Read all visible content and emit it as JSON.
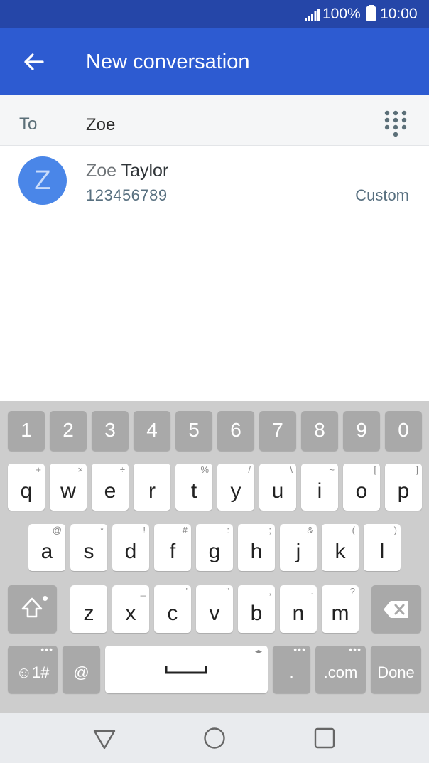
{
  "status_bar": {
    "battery": "100%",
    "time": "10:00"
  },
  "app_bar": {
    "title": "New conversation"
  },
  "recipient": {
    "label": "To",
    "value": "Zoe"
  },
  "contact": {
    "initial": "Z",
    "name_match": "Zoe",
    "name_rest": " Taylor",
    "phone": "123456789",
    "phone_type": "Custom",
    "avatar_color": "#4a86e8"
  },
  "keyboard": {
    "number_row": [
      "1",
      "2",
      "3",
      "4",
      "5",
      "6",
      "7",
      "8",
      "9",
      "0"
    ],
    "row1": [
      {
        "key": "q",
        "alt": "+"
      },
      {
        "key": "w",
        "alt": "×"
      },
      {
        "key": "e",
        "alt": "÷"
      },
      {
        "key": "r",
        "alt": "="
      },
      {
        "key": "t",
        "alt": "%"
      },
      {
        "key": "y",
        "alt": "/"
      },
      {
        "key": "u",
        "alt": "\\"
      },
      {
        "key": "i",
        "alt": "~"
      },
      {
        "key": "o",
        "alt": "["
      },
      {
        "key": "p",
        "alt": "]"
      }
    ],
    "row2": [
      {
        "key": "a",
        "alt": "@"
      },
      {
        "key": "s",
        "alt": "*"
      },
      {
        "key": "d",
        "alt": "!"
      },
      {
        "key": "f",
        "alt": "#"
      },
      {
        "key": "g",
        "alt": ":"
      },
      {
        "key": "h",
        "alt": ";"
      },
      {
        "key": "j",
        "alt": "&"
      },
      {
        "key": "k",
        "alt": "("
      },
      {
        "key": "l",
        "alt": ")"
      }
    ],
    "row3": [
      {
        "key": "z",
        "alt": "–"
      },
      {
        "key": "x",
        "alt": "_"
      },
      {
        "key": "c",
        "alt": "'"
      },
      {
        "key": "v",
        "alt": "\""
      },
      {
        "key": "b",
        "alt": ","
      },
      {
        "key": "n",
        "alt": "."
      },
      {
        "key": "m",
        "alt": "?"
      }
    ],
    "symbols_label": "☺1#",
    "at_label": "@",
    "period_label": ".",
    "dotcom_label": ".com",
    "done_label": "Done"
  },
  "colors": {
    "status_bar": "#2546a8",
    "app_bar": "#2d5bd1",
    "keyboard_bg": "#cdcdcd",
    "key_dark": "#a9a9a9",
    "nav_bar": "#e9ebee"
  }
}
